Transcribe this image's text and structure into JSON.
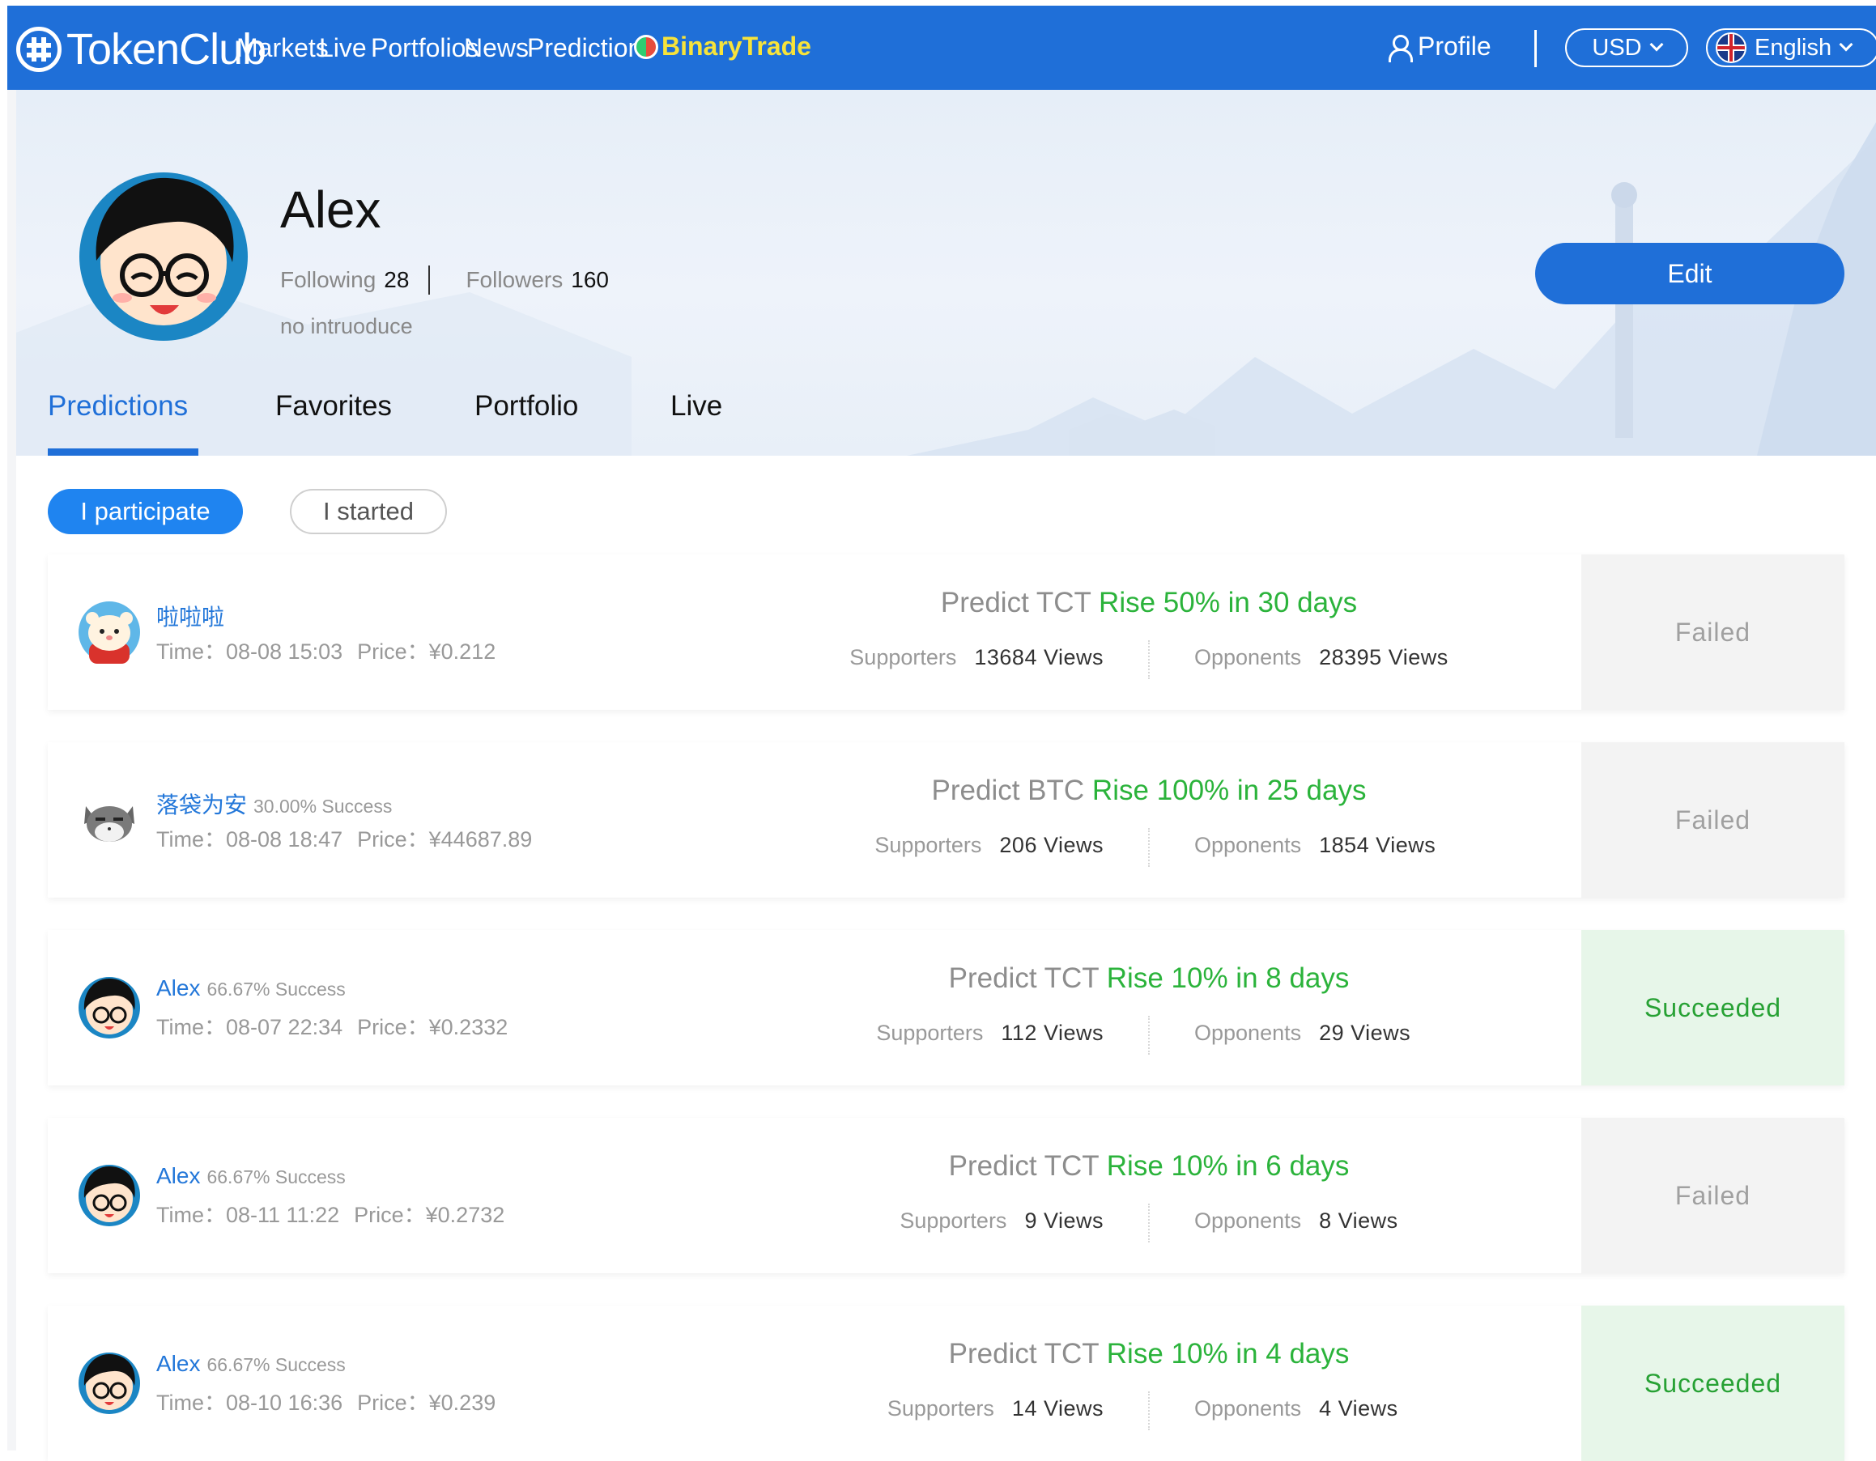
{
  "nav": {
    "brand": "TokenClub",
    "links": [
      "Markets",
      "Live",
      "Portfolios",
      "News",
      "Predictions"
    ],
    "binary_trade": "BinaryTrade",
    "profile": "Profile",
    "currency": "USD",
    "language": "English"
  },
  "profile": {
    "name": "Alex",
    "following_label": "Following",
    "following_count": "28",
    "followers_label": "Followers",
    "followers_count": "160",
    "intro": "no intruoduce",
    "edit_label": "Edit"
  },
  "tabs": [
    {
      "label": "Predictions",
      "active": true
    },
    {
      "label": "Favorites",
      "active": false
    },
    {
      "label": "Portfolio",
      "active": false
    },
    {
      "label": "Live",
      "active": false
    }
  ],
  "filters": {
    "participate": "I participate",
    "started": "I started"
  },
  "labels": {
    "supporters": "Supporters",
    "opponents": "Opponents",
    "time": "Time：",
    "price": "Price："
  },
  "predictions": [
    {
      "user": "啦啦啦",
      "rate": "",
      "time": "08-08 15:03",
      "price": "¥0.212",
      "prefix": "Predict TCT",
      "target": "Rise 50% in 30 days",
      "supporters": "13684 Views",
      "opponents": "28395 Views",
      "status": "Failed",
      "avatar": "hamster"
    },
    {
      "user": "落袋为安",
      "rate": "30.00% Success",
      "time": "08-08 18:47",
      "price": "¥44687.89",
      "prefix": "Predict BTC",
      "target": "Rise 100% in 25 days",
      "supporters": "206 Views",
      "opponents": "1854 Views",
      "status": "Failed",
      "avatar": "cat"
    },
    {
      "user": "Alex",
      "rate": "66.67% Success",
      "time": "08-07 22:34",
      "price": "¥0.2332",
      "prefix": "Predict TCT",
      "target": "Rise 10% in 8 days",
      "supporters": "112 Views",
      "opponents": "29 Views",
      "status": "Succeeded",
      "avatar": "boy"
    },
    {
      "user": "Alex",
      "rate": "66.67% Success",
      "time": "08-11 11:22",
      "price": "¥0.2732",
      "prefix": "Predict TCT",
      "target": "Rise 10% in 6 days",
      "supporters": "9 Views",
      "opponents": "8 Views",
      "status": "Failed",
      "avatar": "boy"
    },
    {
      "user": "Alex",
      "rate": "66.67% Success",
      "time": "08-10 16:36",
      "price": "¥0.239",
      "prefix": "Predict TCT",
      "target": "Rise 10% in 4 days",
      "supporters": "14 Views",
      "opponents": "4 Views",
      "status": "Succeeded",
      "avatar": "boy"
    }
  ],
  "colors": {
    "brand_blue": "#1f6fd8",
    "rise_green": "#2bb33b",
    "success_bg": "#e7f6e9",
    "failed_bg": "#f3f3f3"
  }
}
